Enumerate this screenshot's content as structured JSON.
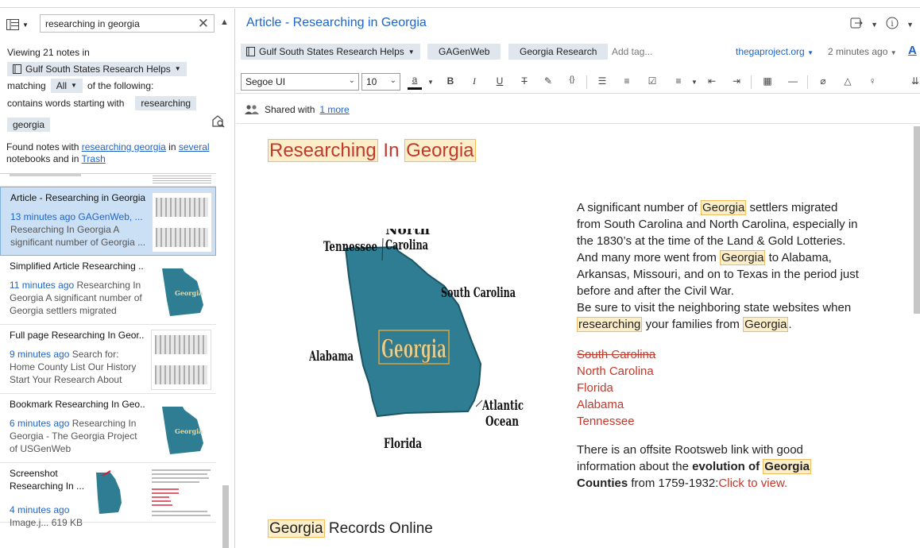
{
  "search": {
    "query": "researching in georgia"
  },
  "filter": {
    "viewing": "Viewing 21 notes in",
    "notebook": "Gulf South States Research Helps",
    "matching": "matching",
    "match_mode": "All",
    "of_following": "of the following:",
    "contains": "contains words starting with",
    "term1": "researching",
    "term2": "georgia"
  },
  "found": {
    "prefix": "Found notes with",
    "link": "researching georgia",
    "in": "in",
    "several": "several",
    "rest": "notebooks and in",
    "trash": "Trash"
  },
  "notes": [
    {
      "title": "Article - Researching in Georgia",
      "time": "13 minutes ago",
      "meta": "GAGenWeb, ...",
      "snippet": "Researching In Georgia A significant number of Georgia ..."
    },
    {
      "title": "Simplified Article Researching ...",
      "time": "11 minutes ago",
      "meta": "Researching In",
      "snippet": "Georgia A significant number of Georgia settlers migrated from..."
    },
    {
      "title": "Full page Researching In Geor...",
      "time": "9 minutes ago",
      "meta": "Search for:",
      "snippet": "Home County List Our History Start Your Research About GA..."
    },
    {
      "title": "Bookmark Researching In Geo...",
      "time": "6 minutes ago",
      "meta": "Researching In",
      "snippet": "Georgia - The Georgia Project of USGenWeb https://thegaproje..."
    },
    {
      "title": "Screenshot Researching In ...",
      "time": "4 minutes ago",
      "meta": "",
      "snippet": "Image.j...     619 KB"
    }
  ],
  "editor": {
    "title": "Article - Researching in Georgia",
    "tags": [
      "Gulf South States Research Helps",
      "GAGenWeb",
      "Georgia Research"
    ],
    "add_tag": "Add tag...",
    "source": "thegaproject.org",
    "modified": "2 minutes ago",
    "font": "Segoe UI",
    "size": "10",
    "shared_prefix": "Shared with",
    "shared_link": "1 more"
  },
  "doc": {
    "h1_a": "Researching",
    "h1_b": "In",
    "h1_c": "Georgia",
    "map_labels": {
      "north_carolina_1": "North",
      "north_carolina_2": "Carolina",
      "tennessee": "Tennessee",
      "south_carolina": "South Carolina",
      "alabama": "Alabama",
      "georgia": "Georgia",
      "atlantic_1": "Atlantic",
      "atlantic_2": "Ocean",
      "florida": "Florida"
    },
    "p1_a": "A significant number of",
    "p1_hl1": "Georgia",
    "p1_b": "settlers migrated from South Carolina and North Carolina, especially in the 1830’s at the time of the Land & Gold Lotteries. And many more went from",
    "p1_hl2": "Georgia",
    "p1_c": "to Alabama, Arkansas, Missouri, and on to Texas in the period just before and after the Civil War.",
    "p2_a": "Be sure to visit the neighboring state websites when",
    "p2_hl1": "researching",
    "p2_b": "your families from",
    "p2_hl2": "Georgia",
    "p2_c": ".",
    "states": [
      "South Carolina",
      "North Carolina",
      "Florida",
      "Alabama",
      "Tennessee"
    ],
    "rw_a": "There is an offsite Rootsweb link with good information about the",
    "rw_bold": "evolution of",
    "rw_hl": "Georgia",
    "rw_bold2": "Counties",
    "rw_b": "from 1759-1932:",
    "rw_link": "Click to view.",
    "h2_hl": "Georgia",
    "h2_rest": "Records Online"
  }
}
